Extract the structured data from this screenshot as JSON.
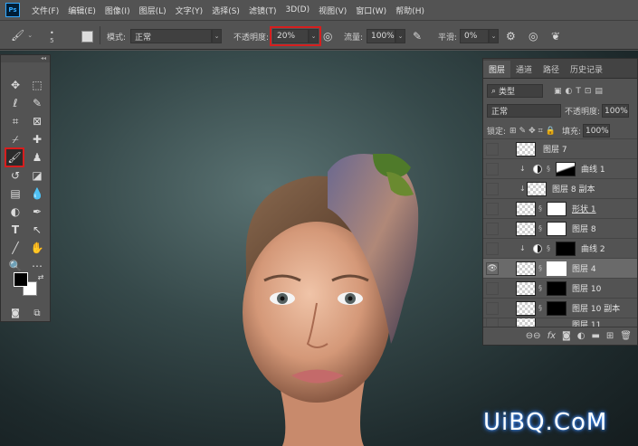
{
  "app": {
    "logo": "Ps"
  },
  "menu": [
    "文件(F)",
    "编辑(E)",
    "图像(I)",
    "图层(L)",
    "文字(Y)",
    "选择(S)",
    "滤镜(T)",
    "3D(D)",
    "视图(V)",
    "窗口(W)",
    "帮助(H)"
  ],
  "options": {
    "brush_size": "5",
    "mode_label": "模式:",
    "mode_value": "正常",
    "opacity_label": "不透明度:",
    "opacity_value": "20%",
    "flow_label": "流量:",
    "flow_value": "100%",
    "smooth_label": "平滑:",
    "smooth_value": "0%"
  },
  "toolbar": {
    "collapse": "◂◂"
  },
  "layers_panel": {
    "tabs": [
      "图层",
      "通道",
      "路径",
      "历史记录"
    ],
    "filter_label": "类型",
    "blend_mode": "正常",
    "opacity_label": "不透明度:",
    "opacity_value": "100%",
    "lock_label": "锁定:",
    "fill_label": "填充:",
    "fill_value": "100%",
    "layers": [
      {
        "name": "图层 7",
        "visible": false,
        "selected": false
      },
      {
        "name": "曲线 1",
        "visible": false,
        "selected": false
      },
      {
        "name": "图层 8 副本",
        "visible": false,
        "selected": false
      },
      {
        "name": "形状 1",
        "visible": false,
        "selected": false
      },
      {
        "name": "图层 8",
        "visible": false,
        "selected": false
      },
      {
        "name": "曲线 2",
        "visible": false,
        "selected": false
      },
      {
        "name": "图层 4",
        "visible": true,
        "selected": true
      },
      {
        "name": "图层 10",
        "visible": false,
        "selected": false
      },
      {
        "name": "图层 10 副本",
        "visible": false,
        "selected": false
      },
      {
        "name": "图层 11",
        "visible": false,
        "selected": false
      }
    ]
  },
  "colors": {
    "highlight": "#d61e1e",
    "panel": "#535353",
    "canvas": "#36494a"
  },
  "watermark": "UiBQ.CoM"
}
